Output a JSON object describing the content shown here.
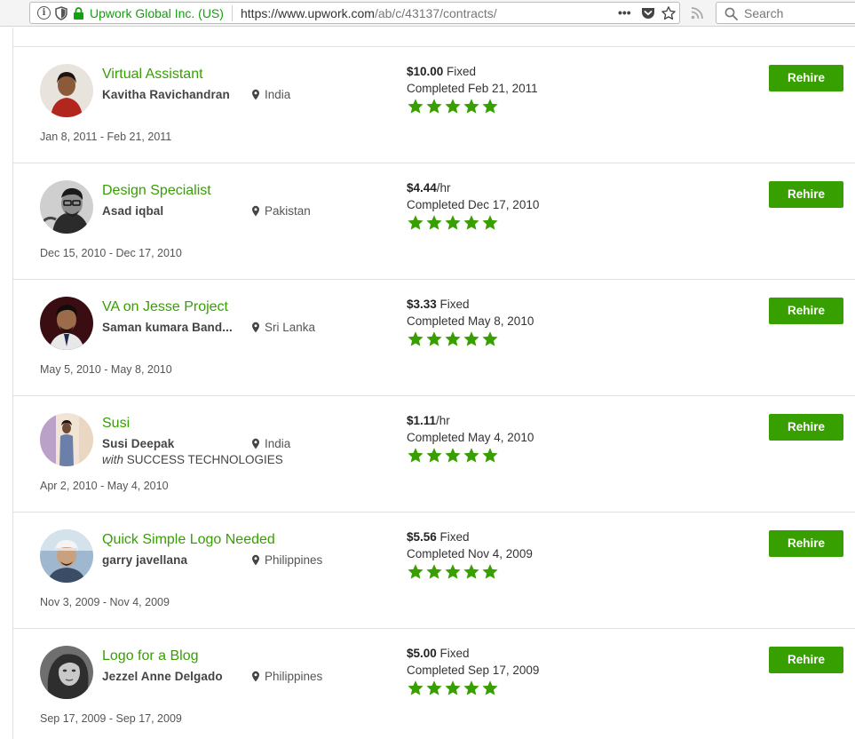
{
  "browser": {
    "identity": "Upwork Global Inc. (US)",
    "url_host": "https://www.upwork.com",
    "url_path": "/ab/c/43137/contracts/",
    "search_placeholder": "Search",
    "more_label": "•••",
    "identity_color": "#13a10e"
  },
  "theme": {
    "accent": "#37a000",
    "star": "#37a000"
  },
  "contracts": [
    {
      "title": "Virtual Assistant",
      "name": "Kavitha Ravichandran",
      "location": "India",
      "company_prefix": "",
      "company": "",
      "dates": "Jan 8, 2011 - Feb 21, 2011",
      "amount": "$10.00",
      "rate_type": " Fixed",
      "completed": "Completed Feb 21, 2011",
      "rating": 5,
      "button": "Rehire",
      "avatar": "portrait-woman"
    },
    {
      "title": "Design Specialist",
      "name": "Asad iqbal",
      "location": "Pakistan",
      "company_prefix": "",
      "company": "",
      "dates": "Dec 15, 2010 - Dec 17, 2010",
      "amount": "$4.44",
      "rate_type": "/hr",
      "completed": "Completed Dec 17, 2010",
      "rating": 5,
      "button": "Rehire",
      "avatar": "portrait-man-glasses"
    },
    {
      "title": "VA on Jesse Project",
      "name": "Saman kumara Band...",
      "location": "Sri Lanka",
      "company_prefix": "",
      "company": "",
      "dates": "May 5, 2010 - May 8, 2010",
      "amount": "$3.33",
      "rate_type": " Fixed",
      "completed": "Completed May 8, 2010",
      "rating": 5,
      "button": "Rehire",
      "avatar": "portrait-man-dark"
    },
    {
      "title": "Susi",
      "name": "Susi Deepak",
      "location": "India",
      "company_prefix": "with",
      "company": " SUCCESS TECHNOLOGIES",
      "dates": "Apr 2, 2010 - May 4, 2010",
      "amount": "$1.11",
      "rate_type": "/hr",
      "completed": "Completed May 4, 2010",
      "rating": 5,
      "button": "Rehire",
      "avatar": "portrait-standing"
    },
    {
      "title": "Quick Simple Logo Needed",
      "name": "garry javellana",
      "location": "Philippines",
      "company_prefix": "",
      "company": "",
      "dates": "Nov 3, 2009 - Nov 4, 2009",
      "amount": "$5.56",
      "rate_type": " Fixed",
      "completed": "Completed Nov 4, 2009",
      "rating": 5,
      "button": "Rehire",
      "avatar": "portrait-man-cap"
    },
    {
      "title": "Logo for a Blog",
      "name": "Jezzel Anne Delgado",
      "location": "Philippines",
      "company_prefix": "",
      "company": "",
      "dates": "Sep 17, 2009 - Sep 17, 2009",
      "amount": "$5.00",
      "rate_type": " Fixed",
      "completed": "Completed Sep 17, 2009",
      "rating": 5,
      "button": "Rehire",
      "avatar": "portrait-woman-bw"
    }
  ]
}
